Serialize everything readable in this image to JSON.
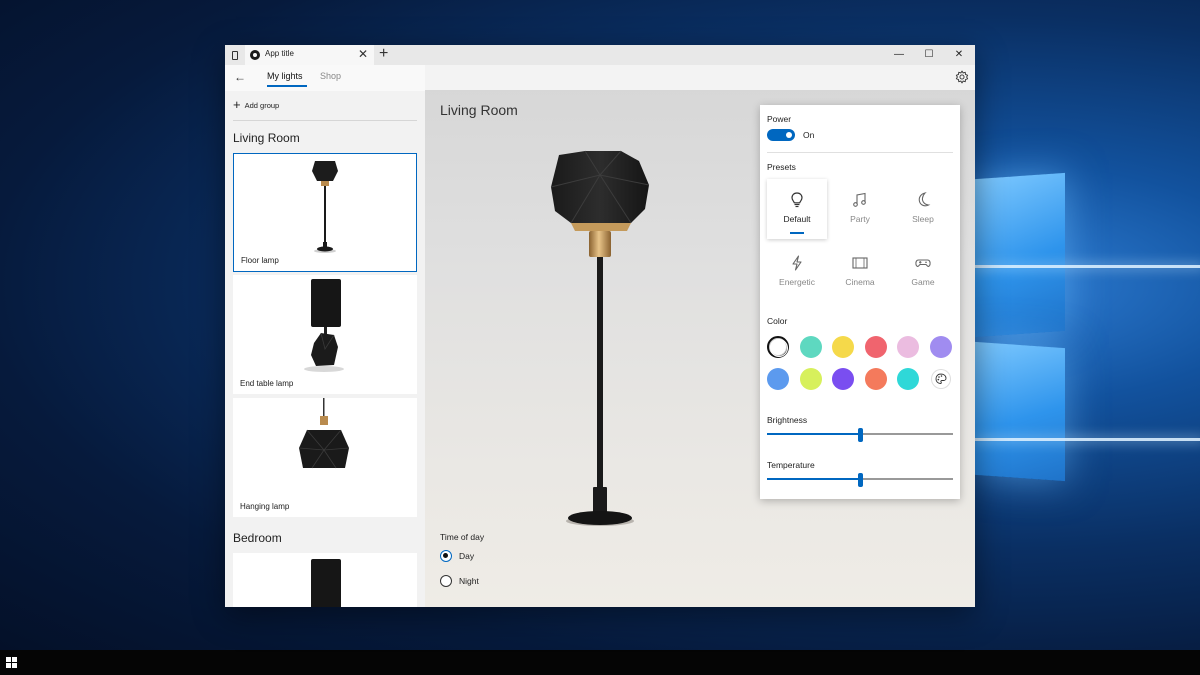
{
  "window": {
    "tab_title": "App title",
    "tab_close": "✕",
    "new_tab": "+",
    "controls": {
      "minimize": "—",
      "maximize": "☐",
      "close": "✕"
    }
  },
  "nav": {
    "back": "←",
    "tabs": [
      {
        "label": "My lights",
        "active": true
      },
      {
        "label": "Shop",
        "active": false
      }
    ]
  },
  "sidebar": {
    "add_group": "Add group",
    "groups": [
      {
        "title": "Living Room",
        "items": [
          {
            "label": "Floor lamp",
            "selected": true
          },
          {
            "label": "End table lamp",
            "selected": false
          },
          {
            "label": "Hanging lamp",
            "selected": false
          }
        ]
      },
      {
        "title": "Bedroom",
        "items": [
          {
            "label": "",
            "selected": false
          }
        ]
      }
    ]
  },
  "main": {
    "room_title": "Living Room",
    "time_of_day": {
      "label": "Time of day",
      "options": [
        {
          "label": "Day",
          "checked": true
        },
        {
          "label": "Night",
          "checked": false
        }
      ]
    }
  },
  "panel": {
    "power": {
      "label": "Power",
      "state_text": "On",
      "on": true
    },
    "presets": {
      "label": "Presets",
      "items": [
        {
          "label": "Default",
          "icon": "lightbulb-icon",
          "active": true
        },
        {
          "label": "Party",
          "icon": "music-notes-icon",
          "active": false
        },
        {
          "label": "Sleep",
          "icon": "moon-icon",
          "active": false
        },
        {
          "label": "Energetic",
          "icon": "lightning-icon",
          "active": false
        },
        {
          "label": "Cinema",
          "icon": "film-icon",
          "active": false
        },
        {
          "label": "Game",
          "icon": "gamepad-icon",
          "active": false
        }
      ]
    },
    "color": {
      "label": "Color",
      "swatches": [
        "#ffffff",
        "#5ed8c0",
        "#f5d94a",
        "#f0646e",
        "#ebbce0",
        "#a08cf0",
        "#5c9aee",
        "#d7f05c",
        "#7a4ef0",
        "#f47a5c",
        "#2fd8d8"
      ],
      "selected_index": 0,
      "custom_icon": "palette-icon"
    },
    "brightness": {
      "label": "Brightness",
      "value": 0.5
    },
    "temperature": {
      "label": "Temperature",
      "value": 0.5
    }
  },
  "colors": {
    "accent": "#0067c0"
  }
}
